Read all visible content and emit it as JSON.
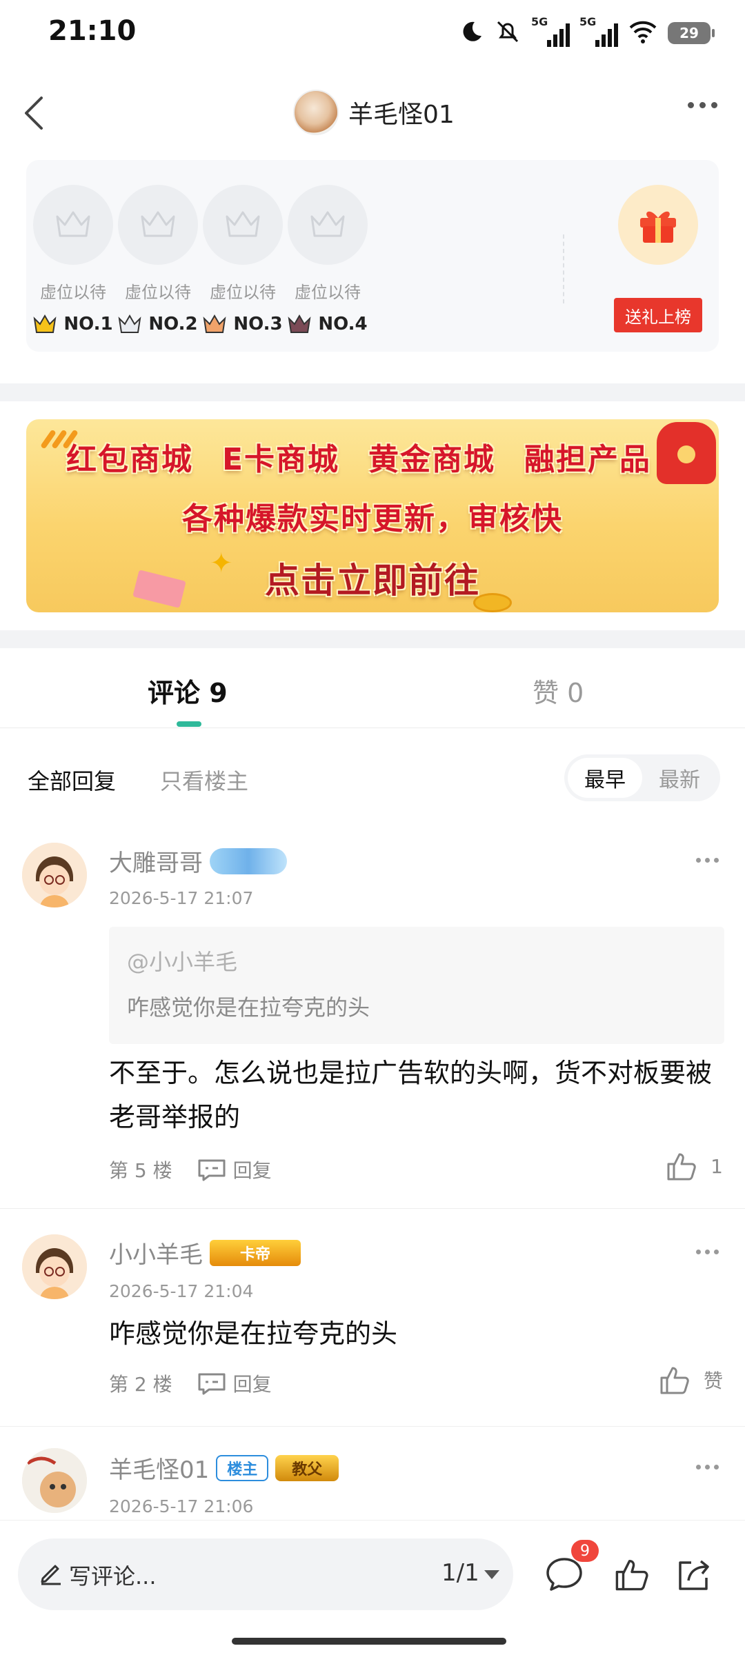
{
  "status_bar": {
    "time": "21:10",
    "signal1_label": "5G",
    "signal2_label": "5G",
    "battery": "29"
  },
  "header": {
    "title": "羊毛怪01"
  },
  "ranking": {
    "slots": [
      {
        "label": "虚位以待",
        "rank": "NO.1"
      },
      {
        "label": "虚位以待",
        "rank": "NO.2"
      },
      {
        "label": "虚位以待",
        "rank": "NO.3"
      },
      {
        "label": "虚位以待",
        "rank": "NO.4"
      }
    ],
    "gift_button": "送礼上榜"
  },
  "banner": {
    "items": [
      "红包商城",
      "E卡商城",
      "黄金商城",
      "融担产品"
    ],
    "slogan": "各种爆款实时更新，审核快",
    "cta": "点击立即前往"
  },
  "tabs": {
    "comments": "评论 9",
    "likes": "赞 0"
  },
  "filters": {
    "all": "全部回复",
    "op_only": "只看楼主",
    "sort_earliest": "最早",
    "sort_latest": "最新"
  },
  "comments": [
    {
      "name": "大雕哥哥",
      "badge": "",
      "time": "2026-5-17 21:07",
      "quote_user": "@小小羊毛",
      "quote_text": "咋感觉你是在拉夸克的头",
      "text": "不至于。怎么说也是拉广告软的头啊，货不对板要被老哥举报的",
      "floor": "第 5 楼",
      "reply": "回复",
      "likes": "1"
    },
    {
      "name": "小小羊毛",
      "badge": "卡帝",
      "time": "2026-5-17 21:04",
      "text": "咋感觉你是在拉夸克的头",
      "floor": "第 2 楼",
      "reply": "回复",
      "likes": "赞"
    },
    {
      "name": "羊毛怪01",
      "badge_owner": "楼主",
      "badge": "教父",
      "time": "2026-5-17 21:06"
    }
  ],
  "bottom_bar": {
    "placeholder": "写评论...",
    "page": "1/1",
    "comment_count": "9"
  },
  "colors": {
    "accent": "#2fb99a",
    "red": "#e8372c",
    "badge_red": "#f0463c"
  }
}
